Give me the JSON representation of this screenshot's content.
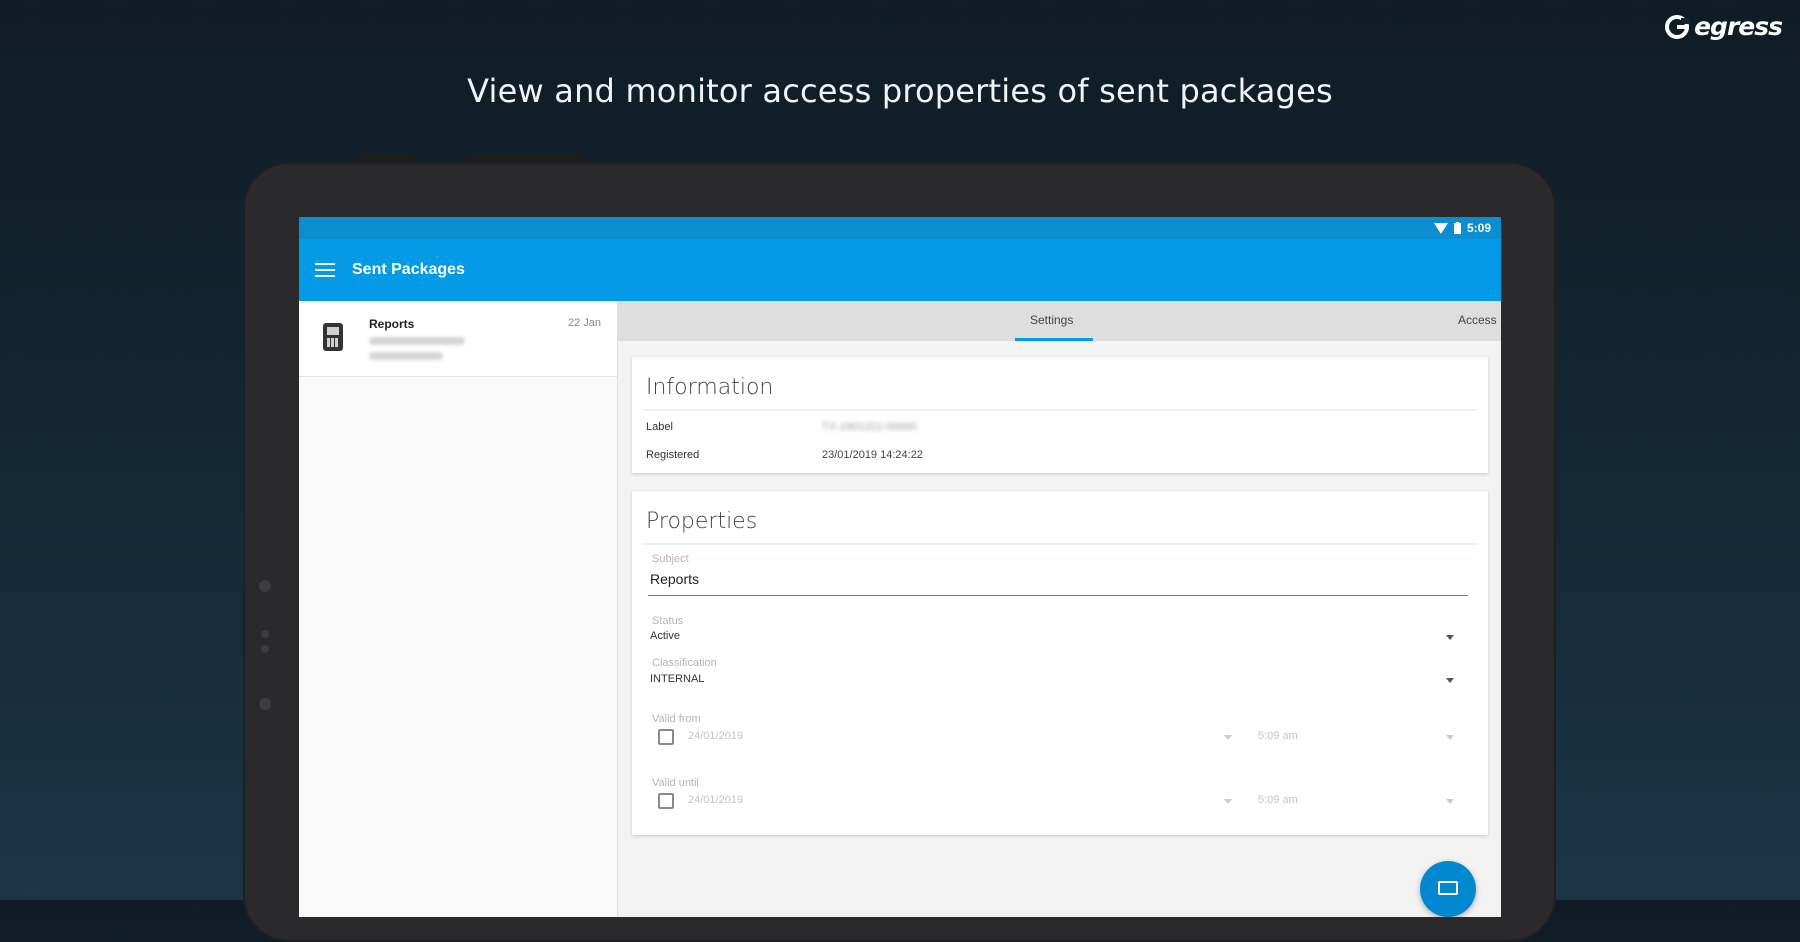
{
  "brand": {
    "name": "egress"
  },
  "headline": "View and monitor access properties of sent packages",
  "status_bar": {
    "time": "5:09"
  },
  "app_bar": {
    "title": "Sent Packages"
  },
  "package_list": [
    {
      "title": "Reports",
      "date": "22 Jan"
    }
  ],
  "tabs": [
    {
      "label": "Settings",
      "selected": true
    },
    {
      "label": "Access",
      "selected": false
    }
  ],
  "information": {
    "title": "Information",
    "label_field": {
      "label": "Label",
      "value": "TX-1901221-00000"
    },
    "registered_field": {
      "label": "Registered",
      "value": "23/01/2019 14:24:22"
    }
  },
  "properties": {
    "title": "Properties",
    "subject": {
      "label": "Subject",
      "value": "Reports"
    },
    "status": {
      "label": "Status",
      "value": "Active"
    },
    "classification": {
      "label": "Classification",
      "value": "INTERNAL"
    },
    "valid_from": {
      "label": "Valid from",
      "date": "24/01/2019",
      "time": "5:09 am",
      "checked": false
    },
    "valid_until": {
      "label": "Valid until",
      "date": "24/01/2019",
      "time": "5:09 am",
      "checked": false
    }
  },
  "colors": {
    "primary": "#039be5",
    "status_bar": "#0a8dd1",
    "fab": "#0288d1"
  }
}
